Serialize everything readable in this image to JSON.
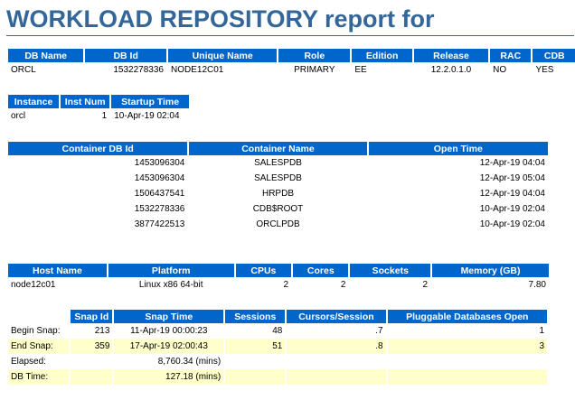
{
  "title": "WORKLOAD REPOSITORY report for",
  "db_table": {
    "headers": [
      "DB Name",
      "DB Id",
      "Unique Name",
      "Role",
      "Edition",
      "Release",
      "RAC",
      "CDB"
    ],
    "row": [
      "ORCL",
      "1532278336",
      "NODE12C01",
      "PRIMARY",
      "EE",
      "12.2.0.1.0",
      "NO",
      "YES"
    ]
  },
  "instance_table": {
    "headers": [
      "Instance",
      "Inst Num",
      "Startup Time"
    ],
    "row": [
      "orcl",
      "1",
      "10-Apr-19 02:04"
    ]
  },
  "container_table": {
    "headers": [
      "Container DB Id",
      "Container Name",
      "Open Time"
    ],
    "rows": [
      [
        "1453096304",
        "SALESPDB",
        "12-Apr-19 04:04"
      ],
      [
        "1453096304",
        "SALESPDB",
        "12-Apr-19 05:04"
      ],
      [
        "1506437541",
        "HRPDB",
        "12-Apr-19 04:04"
      ],
      [
        "1532278336",
        "CDB$ROOT",
        "10-Apr-19 02:04"
      ],
      [
        "3877422513",
        "ORCLPDB",
        "10-Apr-19 02:04"
      ]
    ]
  },
  "host_table": {
    "headers": [
      "Host Name",
      "Platform",
      "CPUs",
      "Cores",
      "Sockets",
      "Memory (GB)"
    ],
    "row": [
      "node12c01",
      "Linux x86 64-bit",
      "2",
      "2",
      "2",
      "7.80"
    ]
  },
  "snap_table": {
    "headers": [
      "",
      "Snap Id",
      "Snap Time",
      "Sessions",
      "Cursors/Session",
      "Pluggable Databases Open"
    ],
    "rows": [
      [
        "Begin Snap:",
        "213",
        "11-Apr-19 00:00:23",
        "48",
        ".7",
        "1"
      ],
      [
        "End Snap:",
        "359",
        "17-Apr-19 02:00:43",
        "51",
        ".8",
        "3"
      ],
      [
        "Elapsed:",
        "",
        "8,760.34 (mins)",
        "",
        "",
        ""
      ],
      [
        "DB Time:",
        "",
        "127.18 (mins)",
        "",
        "",
        ""
      ]
    ]
  },
  "colors": {
    "title": "#336699",
    "header_bg": "#0066cc",
    "header_text": "#ffffff",
    "alt_row_bg": "#ffffcc"
  }
}
